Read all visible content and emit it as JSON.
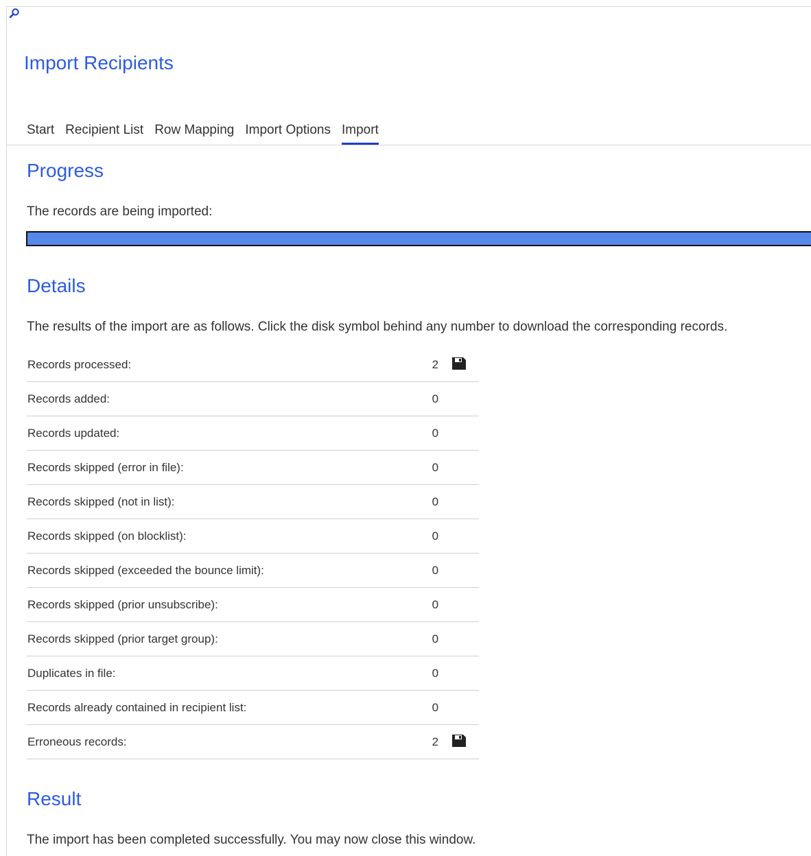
{
  "app_title": "Import Recipients",
  "tabs": [
    {
      "label": "Start",
      "active": false
    },
    {
      "label": "Recipient List",
      "active": false
    },
    {
      "label": "Row Mapping",
      "active": false
    },
    {
      "label": "Import Options",
      "active": false
    },
    {
      "label": "Import",
      "active": true
    }
  ],
  "progress": {
    "heading": "Progress",
    "text": "The records are being imported:",
    "value": 1.0
  },
  "details": {
    "heading": "Details",
    "text": "The results of the import are as follows. Click the disk symbol behind any number to download the corresponding records.",
    "rows": [
      {
        "label": "Records processed:",
        "count": "2",
        "download": true
      },
      {
        "label": "Records added:",
        "count": "0",
        "download": false
      },
      {
        "label": "Records updated:",
        "count": "0",
        "download": false
      },
      {
        "label": "Records skipped (error in file):",
        "count": "0",
        "download": false
      },
      {
        "label": "Records skipped (not in list):",
        "count": "0",
        "download": false
      },
      {
        "label": "Records skipped (on blocklist):",
        "count": "0",
        "download": false
      },
      {
        "label": "Records skipped (exceeded the bounce limit):",
        "count": "0",
        "download": false
      },
      {
        "label": "Records skipped (prior unsubscribe):",
        "count": "0",
        "download": false
      },
      {
        "label": "Records skipped (prior target group):",
        "count": "0",
        "download": false
      },
      {
        "label": "Duplicates in file:",
        "count": "0",
        "download": false
      },
      {
        "label": "Records already contained in recipient list:",
        "count": "0",
        "download": false
      },
      {
        "label": "Erroneous records:",
        "count": "2",
        "download": true
      }
    ]
  },
  "result": {
    "heading": "Result",
    "text": "The import has been completed successfully. You may now close this window."
  },
  "icons": {
    "search": "search-icon",
    "download": "disk-icon"
  },
  "colors": {
    "accent": "#2d5be3",
    "tab_underline": "#1a3fd1",
    "progress_fill": "#5588e8"
  }
}
